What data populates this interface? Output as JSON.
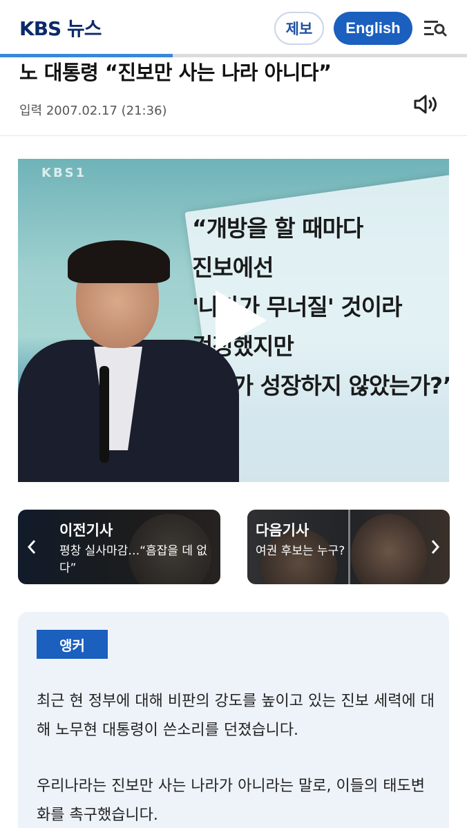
{
  "header": {
    "logo": "KBS 뉴스",
    "report_label": "제보",
    "english_label": "English",
    "menu_icon": "search-menu-icon",
    "read_progress": 0.37
  },
  "article": {
    "title": "노 대통령 “진보만 사는 나라 아니다”",
    "date": "입력 2007.02.17 (21:36)",
    "speaker_icon": "speaker-icon"
  },
  "video": {
    "channel_mark": "KBS1",
    "caption_lines": [
      "“개방을 할 때마다",
      "진보에선",
      "'나라가 무너질' 것이라",
      "걱정했지만",
      "경제가 성장하지 않았는가?”"
    ],
    "play_icon": "play-icon"
  },
  "nav": {
    "prev": {
      "label": "이전기사",
      "text": "평창 실사마감…“흠잡을 데 없다”"
    },
    "next": {
      "label": "다음기사",
      "text": "여권 후보는 누구?"
    }
  },
  "body": {
    "badge": "앵커",
    "paragraphs": [
      "최근 현 정부에 대해 비판의 강도를 높이고 있는 진보 세력에 대해 노무현 대통령이 쓴소리를 던졌습니다.",
      "우리나라는 진보만 사는 나라가 아니라는 말로, 이들의 태도변화를 촉구했습니다."
    ]
  },
  "colors": {
    "brand_blue": "#1b5fbf",
    "logo_navy": "#0b2a6b",
    "progress": "#3a86d9",
    "body_bg": "#eef3f9"
  }
}
